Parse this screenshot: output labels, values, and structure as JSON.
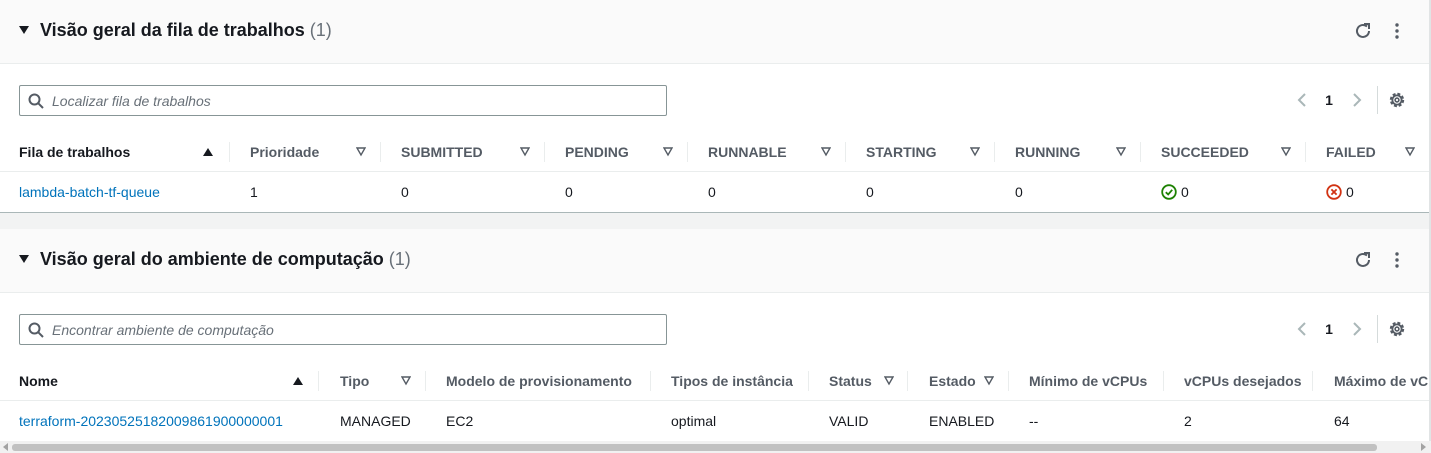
{
  "queue_panel": {
    "title": "Visão geral da fila de trabalhos",
    "count": "(1)",
    "search_placeholder": "Localizar fila de trabalhos",
    "page": "1",
    "columns": [
      "Fila de trabalhos",
      "Prioridade",
      "SUBMITTED",
      "PENDING",
      "RUNNABLE",
      "STARTING",
      "RUNNING",
      "SUCCEEDED",
      "FAILED"
    ],
    "rows": [
      {
        "name": "lambda-batch-tf-queue",
        "priority": "1",
        "submitted": "0",
        "pending": "0",
        "runnable": "0",
        "starting": "0",
        "running": "0",
        "succeeded": "0",
        "failed": "0"
      }
    ]
  },
  "env_panel": {
    "title": "Visão geral do ambiente de computação",
    "count": "(1)",
    "search_placeholder": "Encontrar ambiente de computação",
    "page": "1",
    "columns": [
      "Nome",
      "Tipo",
      "Modelo de provisionamento",
      "Tipos de instância",
      "Status",
      "Estado",
      "Mínimo de vCPUs",
      "vCPUs desejados",
      "Máximo de vCPUs"
    ],
    "rows": [
      {
        "name": "terraform-20230525182009861900000001",
        "type": "MANAGED",
        "provisioning": "EC2",
        "instance_types": "optimal",
        "status": "VALID",
        "state": "ENABLED",
        "min_vcpus": "--",
        "desired_vcpus": "2",
        "max_vcpus": "64"
      }
    ]
  },
  "icons": {
    "refresh": "refresh-icon",
    "more": "more-vertical-icon",
    "settings": "gear-icon",
    "search": "search-icon",
    "success": "check-circle-icon",
    "error": "x-circle-icon"
  },
  "colors": {
    "link": "#0073bb",
    "success": "#1d8102",
    "error": "#d13212"
  }
}
